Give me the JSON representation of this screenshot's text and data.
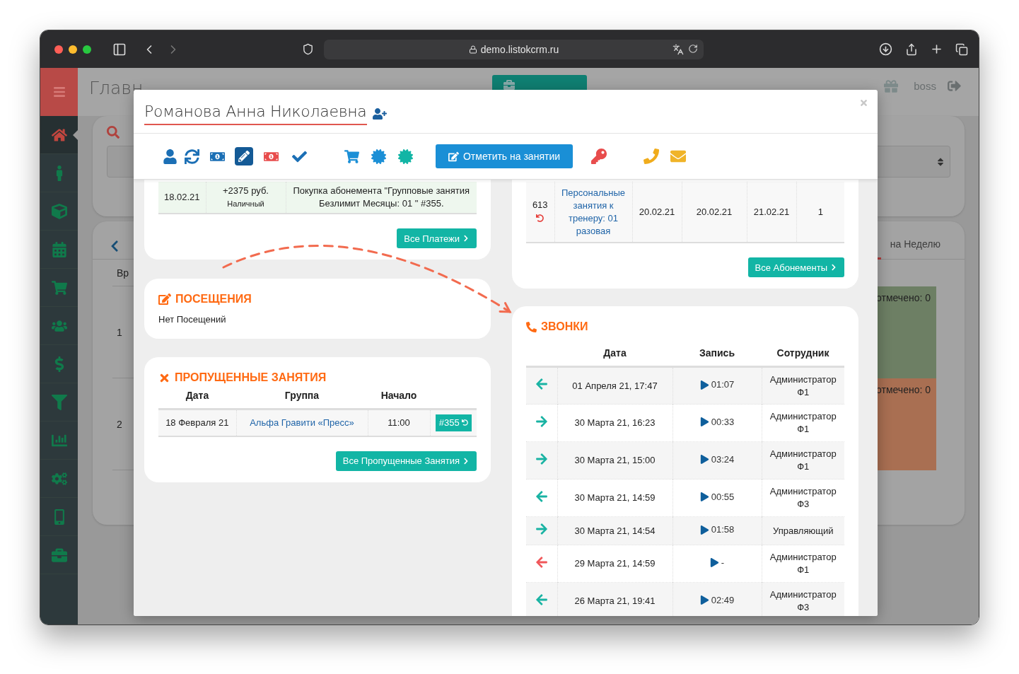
{
  "browser": {
    "url": "demo.listokcrm.ru"
  },
  "app": {
    "page_title": "Главн",
    "user": "boss",
    "sidebar": [
      {
        "selected": true
      },
      {
        "selected": false
      },
      {
        "selected": false
      },
      {
        "selected": false
      },
      {
        "selected": false
      },
      {
        "selected": false
      },
      {
        "selected": false
      },
      {
        "selected": false
      },
      {
        "selected": false
      },
      {
        "selected": false
      },
      {
        "selected": false
      },
      {
        "selected": false
      }
    ],
    "schedule": {
      "column_header": "Вр",
      "row_numbers": [
        "1",
        "2"
      ],
      "tab": {
        "label": "на Неделю",
        "selected": false
      },
      "slots": [
        {
          "text": "отмечено: 0",
          "color": "#6d7f64"
        },
        {
          "text": "отмечено: 0",
          "color": "#a96f52"
        }
      ]
    }
  },
  "modal": {
    "title": "Романова Анна Николаевна",
    "tools": [
      {
        "selected": false
      },
      {
        "selected": false
      },
      {
        "selected": false
      },
      {
        "selected": true
      },
      {
        "selected": false
      },
      {
        "selected": false
      },
      {
        "selected": false
      },
      {
        "selected": false
      },
      {
        "selected": false
      }
    ],
    "mark_button": "Отметить на занятии",
    "contact_tools": [
      {
        "selected": false
      },
      {
        "selected": false
      },
      {
        "selected": false
      }
    ],
    "payments": {
      "rows": [
        {
          "date": "18.02.21",
          "amount": "+2375 руб.",
          "method": "Наличный",
          "description": "Покупка абонемента \"Групповые занятия Безлимит Месяцы: 01 \" #355."
        }
      ],
      "button": "Все Платежи"
    },
    "visits": {
      "title": "ПОСЕЩЕНИЯ",
      "empty": "Нет Посещений"
    },
    "missed": {
      "title": "ПРОПУЩЕННЫЕ ЗАНЯТИЯ",
      "columns": [
        "Дата",
        "Группа",
        "Начало"
      ],
      "rows": [
        {
          "date": "18 Февраля 21",
          "group": "Альфа Гравити «Пресс»",
          "start": "11:00",
          "badge": "#355"
        }
      ],
      "button": "Все Пропущенные Занятия"
    },
    "subscriptions": {
      "rows": [
        {
          "id": "613",
          "name": "Персональные занятия к тренеру: 01 разовая",
          "date_1": "20.02.21",
          "date_2": "20.02.21",
          "date_3": "21.02.21",
          "count": "1"
        }
      ],
      "button": "Все Абонементы"
    },
    "calls": {
      "title": "ЗВОНКИ",
      "columns": [
        "Дата",
        "Запись",
        "Сотрудник"
      ],
      "rows": [
        {
          "kind": "incoming",
          "date": "01 Апреля 21, 17:47",
          "duration": "01:07",
          "employee": "Администратор Ф1"
        },
        {
          "kind": "outgoing",
          "date": "30 Марта 21, 16:23",
          "duration": "00:33",
          "employee": "Администратор Ф1"
        },
        {
          "kind": "outgoing",
          "date": "30 Марта 21, 15:00",
          "duration": "03:24",
          "employee": "Администратор Ф1"
        },
        {
          "kind": "incoming",
          "date": "30 Марта 21, 14:59",
          "duration": "00:55",
          "employee": "Администратор Ф3"
        },
        {
          "kind": "outgoing",
          "date": "30 Марта 21, 14:54",
          "duration": "01:58",
          "employee": "Управляющий"
        },
        {
          "kind": "missed",
          "date": "29 Марта 21, 14:59",
          "duration": "-",
          "employee": "Администратор Ф1"
        },
        {
          "kind": "incoming",
          "date": "26 Марта 21, 19:41",
          "duration": "02:49",
          "employee": "Администратор Ф3"
        }
      ]
    }
  }
}
